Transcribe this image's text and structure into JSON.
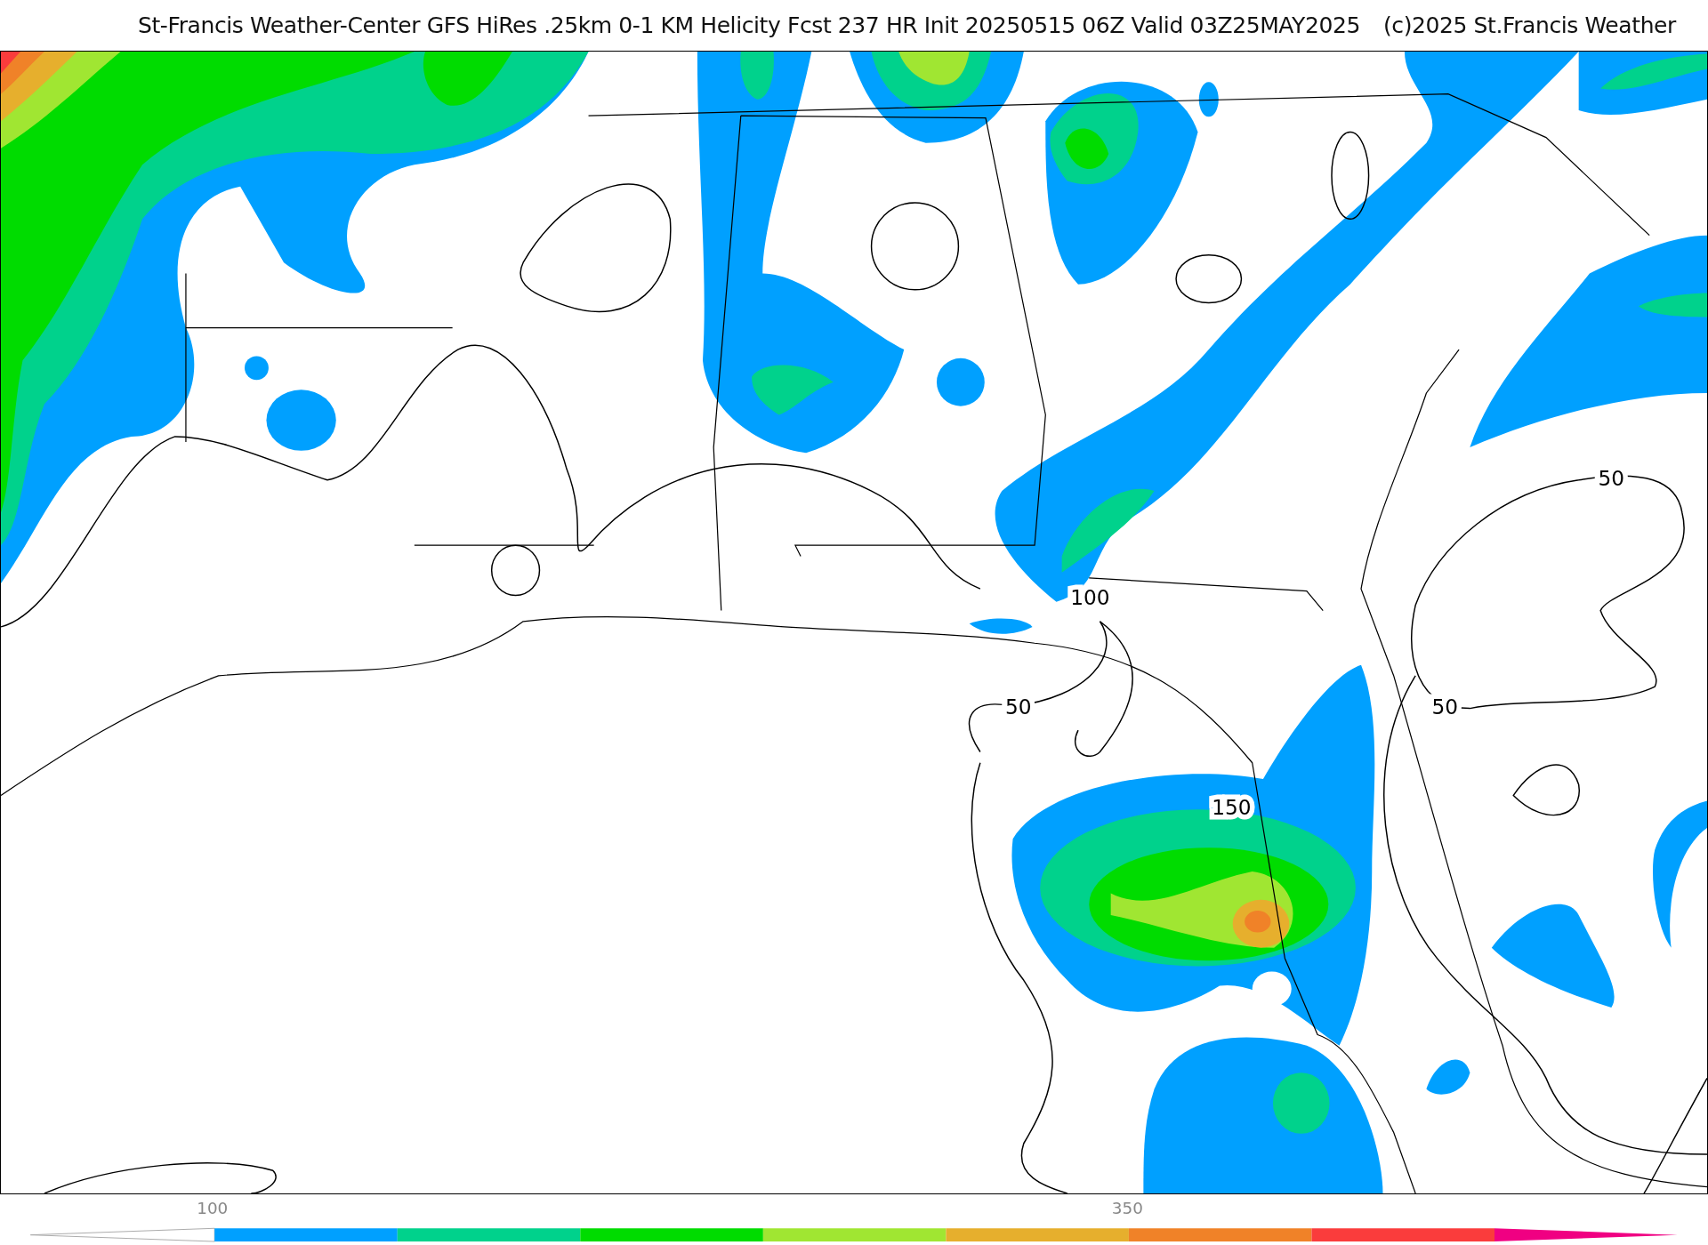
{
  "header": {
    "title": "St-Francis Weather-Center GFS HiRes .25km 0-1 KM Helicity Fcst 237 HR Init 20250515 06Z  Valid 03Z25MAY2025",
    "credit": "(c)2025 St.Francis Weather"
  },
  "contour_labels": [
    {
      "text": "50"
    },
    {
      "text": "100"
    },
    {
      "text": "50"
    },
    {
      "text": "50"
    },
    {
      "text": "150"
    }
  ],
  "colorbar": {
    "labels": [
      {
        "text": "100"
      },
      {
        "text": "350"
      }
    ],
    "segments": [
      {
        "kind": "low_arrow",
        "color": "#ffffff"
      },
      {
        "kind": "band",
        "color": "#00a0ff"
      },
      {
        "kind": "band",
        "color": "#00d28c"
      },
      {
        "kind": "band",
        "color": "#00dc00"
      },
      {
        "kind": "band",
        "color": "#a0e632"
      },
      {
        "kind": "band",
        "color": "#e6af2d"
      },
      {
        "kind": "band",
        "color": "#f08228"
      },
      {
        "kind": "band",
        "color": "#fa3c3c"
      },
      {
        "kind": "high_arrow",
        "color": "#f00082"
      }
    ]
  }
}
